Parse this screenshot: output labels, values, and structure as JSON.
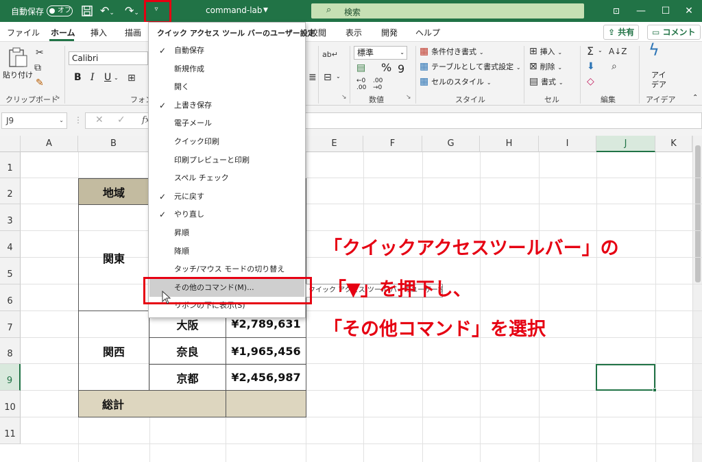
{
  "titlebar": {
    "autosave_label": "自動保存",
    "autosave_state": "オフ",
    "workbook_name": "command-lab",
    "search_placeholder": "検索"
  },
  "tabs": [
    "ファイル",
    "ホーム",
    "挿入",
    "描画",
    "校閲",
    "表示",
    "開発",
    "ヘルプ"
  ],
  "share_button": "共有",
  "comment_button": "コメント",
  "ribbon": {
    "paste_label": "貼り付け",
    "clipboard_group": "クリップボード",
    "font_name": "Calibri",
    "font_group_partial": "フォン",
    "number_format": "標準",
    "number_group": "数値",
    "conditional_format": "条件付き書式",
    "format_as_table": "テーブルとして書式設定",
    "cell_styles": "セルのスタイル",
    "styles_group": "スタイル",
    "insert": "挿入",
    "delete": "削除",
    "format": "書式",
    "cells_group": "セル",
    "editing_group": "編集",
    "ideas_label1": "アイ",
    "ideas_label2": "デア",
    "ideas_group": "アイデア"
  },
  "formula_bar": {
    "name_box": "J9",
    "fx": "fx"
  },
  "columns": [
    "A",
    "B",
    "E",
    "F",
    "G",
    "H",
    "I",
    "J",
    "K"
  ],
  "rows": [
    "1",
    "2",
    "3",
    "4",
    "5",
    "6",
    "7",
    "8",
    "9",
    "10",
    "11"
  ],
  "table": {
    "header_region": "地域",
    "kanto": "関東",
    "kansai": "関西",
    "osaka": "大阪",
    "osaka_value": "¥2,789,631",
    "nara": "奈良",
    "nara_value": "¥1,965,456",
    "kyoto": "京都",
    "kyoto_value": "¥2,456,987",
    "total": "総計"
  },
  "qat_menu": {
    "title": "クイック アクセス ツール バーのユーザー設定",
    "items": [
      {
        "label": "自動保存",
        "checked": "✓"
      },
      {
        "label": "新規作成",
        "checked": ""
      },
      {
        "label": "開く",
        "checked": ""
      },
      {
        "label": "上書き保存",
        "checked": "✓"
      },
      {
        "label": "電子メール",
        "checked": ""
      },
      {
        "label": "クイック印刷",
        "checked": ""
      },
      {
        "label": "印刷プレビューと印刷",
        "checked": ""
      },
      {
        "label": "スペル チェック",
        "checked": ""
      },
      {
        "label": "元に戻す",
        "checked": "✓"
      },
      {
        "label": "やり直し",
        "checked": "✓"
      },
      {
        "label": "昇順",
        "checked": ""
      },
      {
        "label": "降順",
        "checked": ""
      },
      {
        "label": "タッチ/マウス モードの切り替え",
        "checked": ""
      },
      {
        "label": "その他のコマンド(M)...",
        "checked": ""
      },
      {
        "label": "リボンの下に表示(S)",
        "checked": ""
      }
    ],
    "tooltip": "クイック アクセス ツール バーのユーザー設定"
  },
  "annotation": {
    "line1": "「クイックアクセスツールバー」の",
    "line2": "「▼」を押下し、",
    "line3": "「その他コマンド」を選択"
  },
  "colors": {
    "excel_green": "#217346",
    "annotation_red": "#e60012",
    "table_header": "#c3bba0",
    "table_total": "#ddd6bf"
  }
}
